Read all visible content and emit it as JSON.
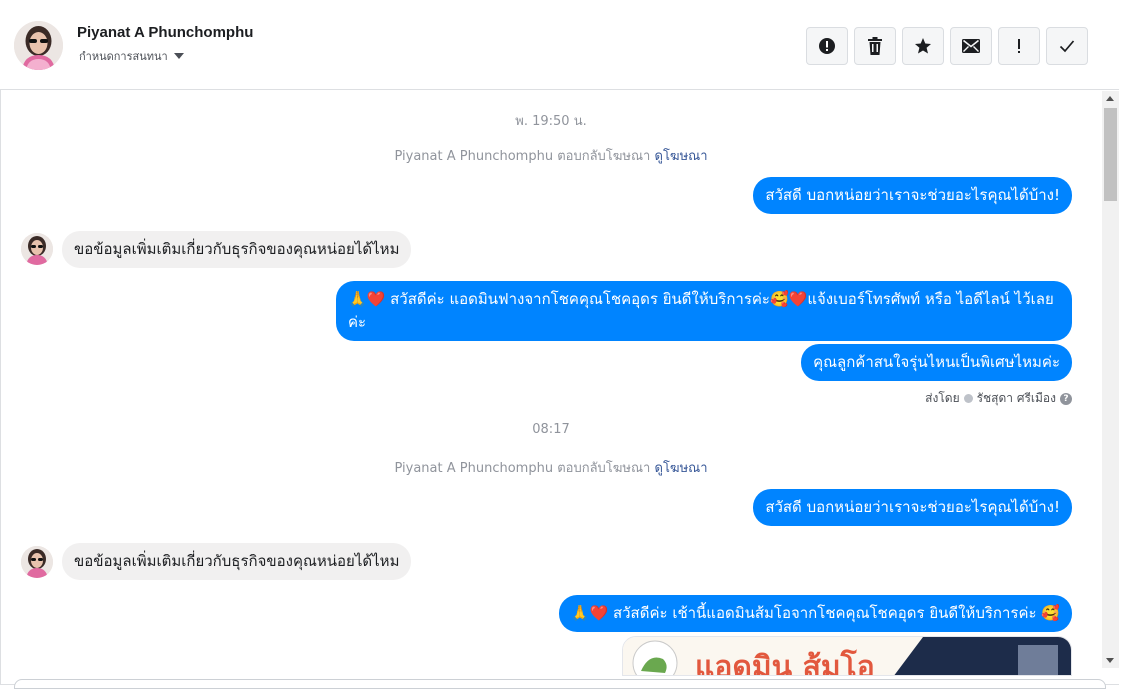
{
  "header": {
    "contact_name": "Piyanat A Phunchomphu",
    "assign_label": "กำหนดการสนทนา",
    "toolbar": [
      {
        "name": "report-spam-button",
        "icon": "alert-circle-icon"
      },
      {
        "name": "delete-button",
        "icon": "trash-icon"
      },
      {
        "name": "star-button",
        "icon": "star-icon"
      },
      {
        "name": "mark-unread-button",
        "icon": "envelope-icon"
      },
      {
        "name": "mark-priority-button",
        "icon": "exclamation-icon"
      },
      {
        "name": "mark-done-button",
        "icon": "checkmark-icon"
      }
    ]
  },
  "thread": {
    "timestamp_1": "พ. 19:50 น.",
    "ad_reply_1": {
      "text": "Piyanat A Phunchomphu ตอบกลับโฆษณา",
      "link": "ดูโฆษณา"
    },
    "out_1": "สวัสดี บอกหน่อยว่าเราจะช่วยอะไรคุณได้บ้าง!",
    "in_1": "ขอข้อมูลเพิ่มเติมเกี่ยวกับธุรกิจของคุณหน่อยได้ไหม",
    "out_2_line1": "🙏❤️ สวัสดีค่ะ แอดมินฟางจากโชคคุณโชคอุดร ยินดีให้บริการค่ะ🥰❤️แจ้งเบอร์โทรศัพท์ หรือ ไอดีไลน์  ไว้เลย",
    "out_2_line2": "ค่ะ",
    "out_3": "คุณลูกค้าสนใจรุ่นไหนเป็นพิเศษไหมค่ะ",
    "sent_by_label": "ส่งโดย",
    "sent_by_name": "รัชสุดา ศรีเมือง",
    "timestamp_2": "08:17",
    "ad_reply_2": {
      "text": "Piyanat A Phunchomphu ตอบกลับโฆษณา",
      "link": "ดูโฆษณา"
    },
    "out_4": "สวัสดี บอกหน่อยว่าเราจะช่วยอะไรคุณได้บ้าง!",
    "in_2": "ขอข้อมูลเพิ่มเติมเกี่ยวกับธุรกิจของคุณหน่อยได้ไหม",
    "out_5": "🙏❤️ สวัสดีค่ะ เช้านี้แอดมินส้มโอจากโชคคุณโชคอุดร ยินดีให้บริการค่ะ 🥰",
    "image_caption": "แอดมิน ส้มโอ"
  },
  "colors": {
    "outgoing_bubble": "#0084ff",
    "incoming_bubble": "#f1f0f0",
    "link": "#385898"
  }
}
